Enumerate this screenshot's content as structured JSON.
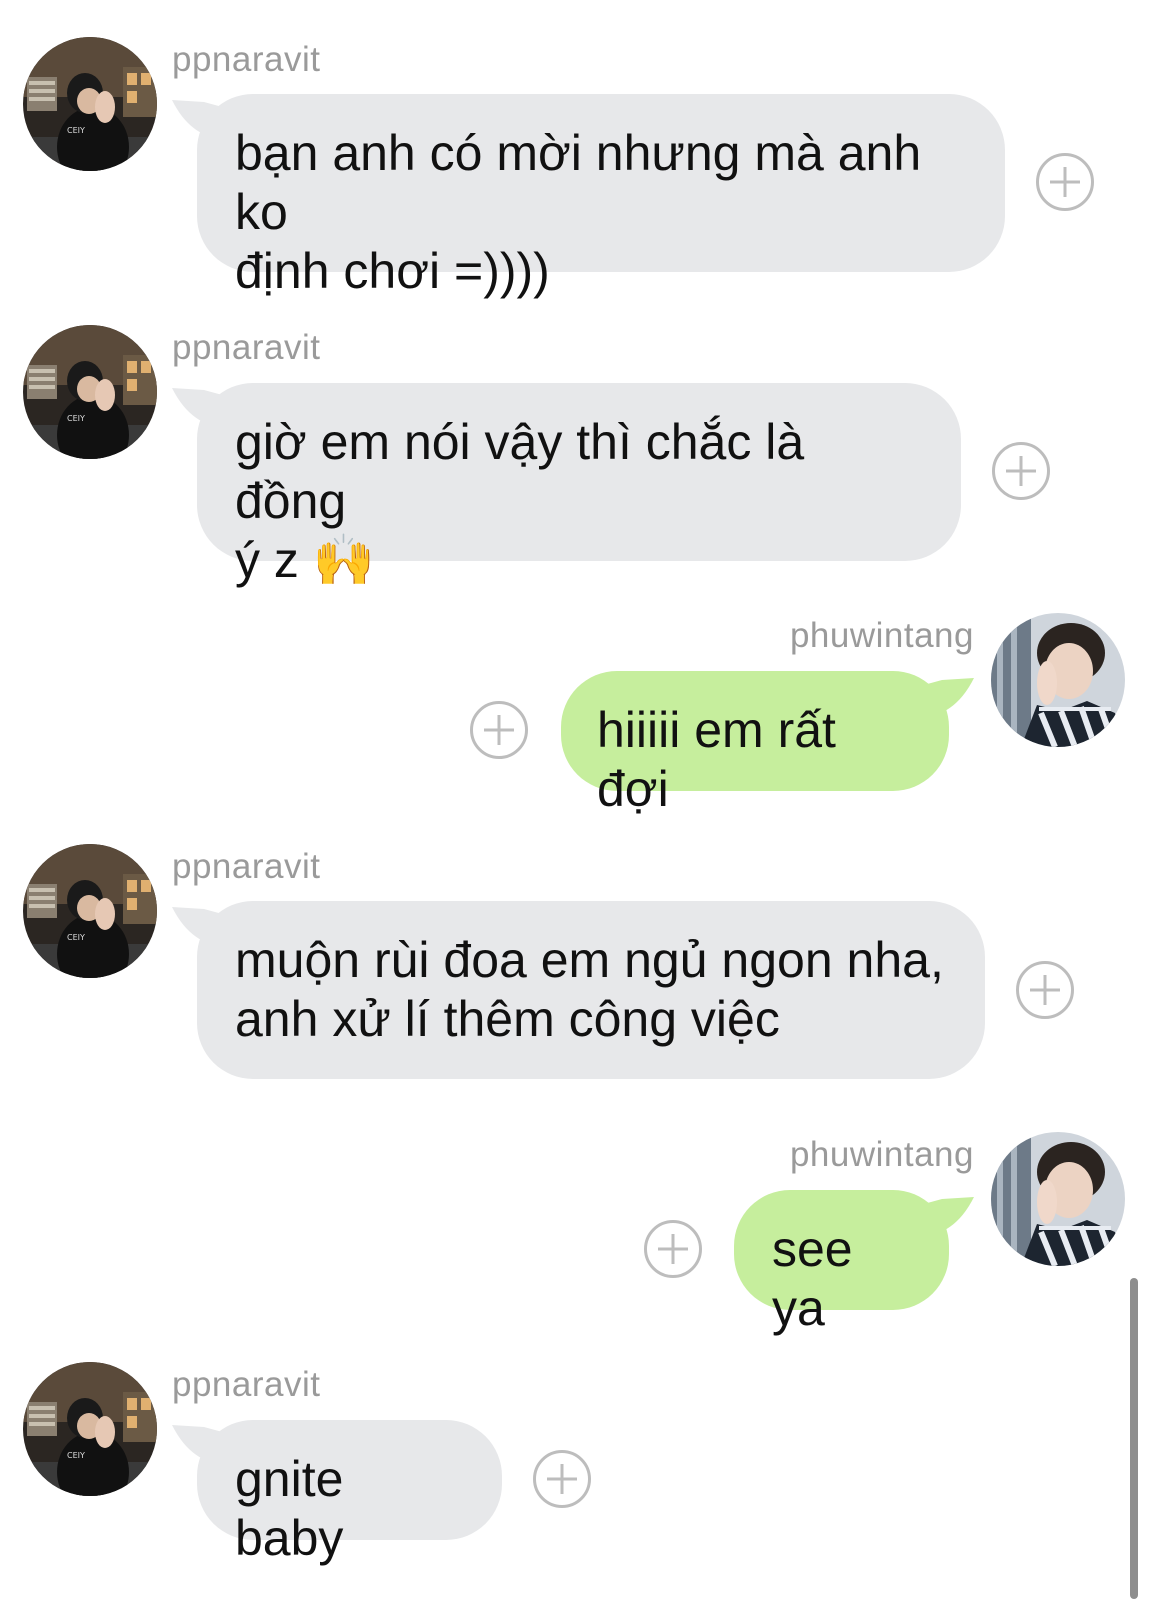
{
  "conversation": {
    "messages": [
      {
        "sender": "ppnaravit",
        "direction": "incoming",
        "text": "bạn anh có mời nhưng mà anh ko\nđịnh chơi =))))"
      },
      {
        "sender": "ppnaravit",
        "direction": "incoming",
        "text": "giờ em nói vậy thì chắc là đồng\ný z 🙌"
      },
      {
        "sender": "phuwintang",
        "direction": "outgoing",
        "text": "hiiiii em rất đợi"
      },
      {
        "sender": "ppnaravit",
        "direction": "incoming",
        "text": "muộn rùi đoa em ngủ ngon nha,\nanh xử lí thêm công việc"
      },
      {
        "sender": "phuwintang",
        "direction": "outgoing",
        "text": "see ya"
      },
      {
        "sender": "ppnaravit",
        "direction": "incoming",
        "text": "gnite baby"
      }
    ]
  },
  "colors": {
    "incoming_bubble": "#e7e8ea",
    "outgoing_bubble": "#c6ee9d",
    "username": "#9a9a9a",
    "plus_icon": "#bdbdbd"
  },
  "icons": {
    "add_reaction": "plus-circle-icon",
    "avatar_left": "avatar-ppnaravit",
    "avatar_right": "avatar-phuwintang"
  }
}
